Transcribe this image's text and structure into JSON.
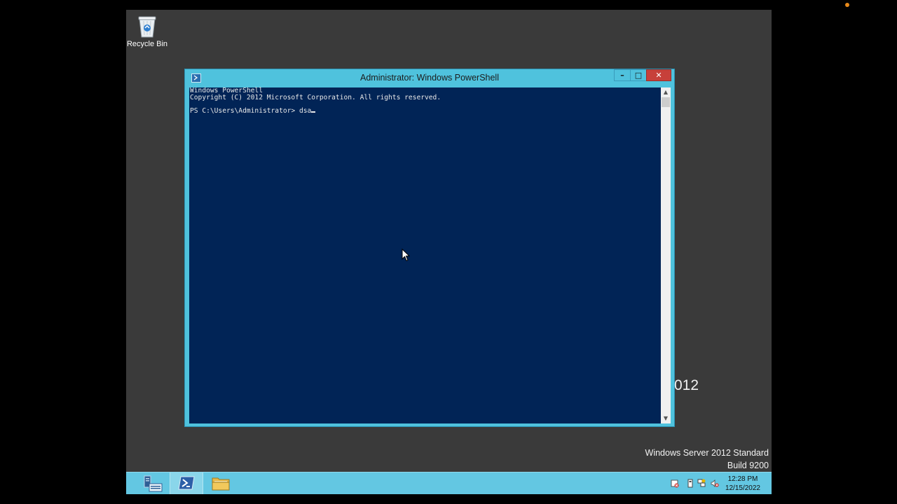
{
  "desktop": {
    "recycle_bin_label": "Recycle Bin",
    "brand_partial": "012",
    "watermark_line1": "Windows Server 2012 Standard",
    "watermark_line2": "Build 9200"
  },
  "window": {
    "title": "Administrator: Windows PowerShell",
    "minimize_glyph": "–",
    "maximize_glyph": "□",
    "close_glyph": "✕"
  },
  "console": {
    "lines": [
      "Windows PowerShell",
      "Copyright (C) 2012 Microsoft Corporation. All rights reserved.",
      "",
      "PS C:\\Users\\Administrator> dsa"
    ],
    "prompt": "PS C:\\Users\\Administrator> ",
    "typed_text": "dsa"
  },
  "scrollbar": {
    "up_glyph": "▲",
    "down_glyph": "▼"
  },
  "taskbar": {
    "items": [
      {
        "name": "Server Manager",
        "icon": "server-manager-icon"
      },
      {
        "name": "Windows PowerShell",
        "icon": "powershell-icon"
      },
      {
        "name": "File Explorer",
        "icon": "folder-icon"
      }
    ],
    "tray_icons": [
      "action-center-icon",
      "power-icon",
      "network-icon",
      "volume-icon"
    ],
    "clock_time": "12:28 PM",
    "clock_date": "12/15/2022"
  },
  "colors": {
    "console_bg": "#012456",
    "accent": "#4fc2dd",
    "close_button": "#c7403a",
    "desktop_bg": "#3a3a3a"
  }
}
